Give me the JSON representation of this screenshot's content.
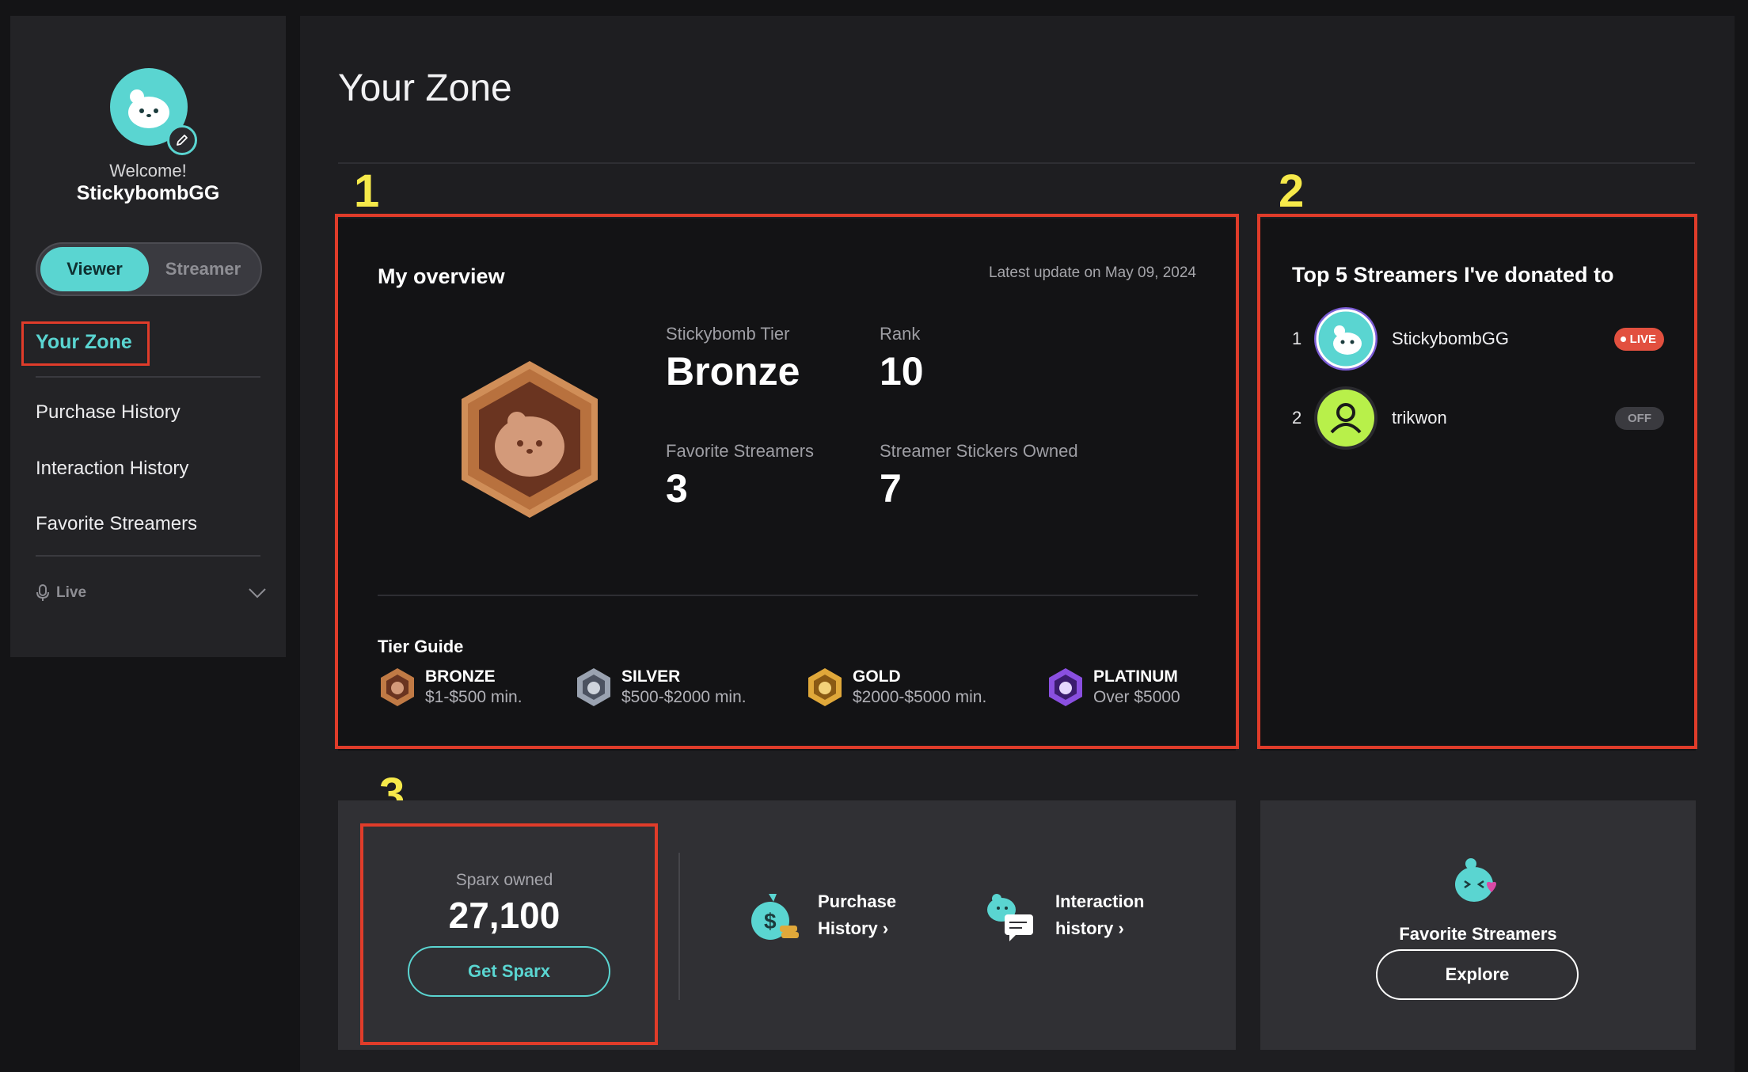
{
  "sidebar": {
    "welcome": "Welcome!",
    "username": "StickybombGG",
    "roles": [
      "Viewer",
      "Streamer"
    ],
    "nav": {
      "active": "Your Zone",
      "items": [
        "Purchase History",
        "Interaction History",
        "Favorite Streamers"
      ]
    },
    "live": {
      "label": "Live"
    }
  },
  "main": {
    "title": "Your Zone",
    "annotations": [
      "1",
      "2",
      "3"
    ],
    "overview": {
      "title": "My overview",
      "latest": "Latest update on May 09, 2024",
      "stats": [
        {
          "label": "Stickybomb Tier",
          "value": "Bronze"
        },
        {
          "label": "Rank",
          "value": "10"
        },
        {
          "label": "Favorite Streamers",
          "value": "3"
        },
        {
          "label": "Streamer Stickers Owned",
          "value": "7"
        }
      ],
      "tier_guide_title": "Tier Guide",
      "tiers": [
        {
          "name": "BRONZE",
          "range": "$1-$500 min.",
          "color": "#c07a45"
        },
        {
          "name": "SILVER",
          "range": "$500-$2000 min.",
          "color": "#9aa2b0"
        },
        {
          "name": "GOLD",
          "range": "$2000-$5000 min.",
          "color": "#e0a83a"
        },
        {
          "name": "PLATINUM",
          "range": "Over $5000",
          "color": "#8a4fe0"
        }
      ]
    },
    "top5": {
      "title": "Top 5 Streamers I've donated to",
      "streamers": [
        {
          "rank": "1",
          "name": "StickybombGG",
          "status": "LIVE"
        },
        {
          "rank": "2",
          "name": "trikwon",
          "status": "OFF"
        }
      ]
    },
    "sparx": {
      "label": "Sparx owned",
      "value": "27,100",
      "button": "Get Sparx"
    },
    "shortcuts": [
      {
        "line1": "Purchase",
        "line2": "History",
        "icon": "money-bag-icon"
      },
      {
        "line1": "Interaction",
        "line2": "history",
        "icon": "chat-icon"
      }
    ],
    "favorites": {
      "title": "Favorite Streamers",
      "button": "Explore"
    }
  },
  "colors": {
    "accent": "#5ad5d1",
    "annotation_box": "#e03c2a",
    "annotation_number": "#f6e94a",
    "live": "#e2503f"
  }
}
